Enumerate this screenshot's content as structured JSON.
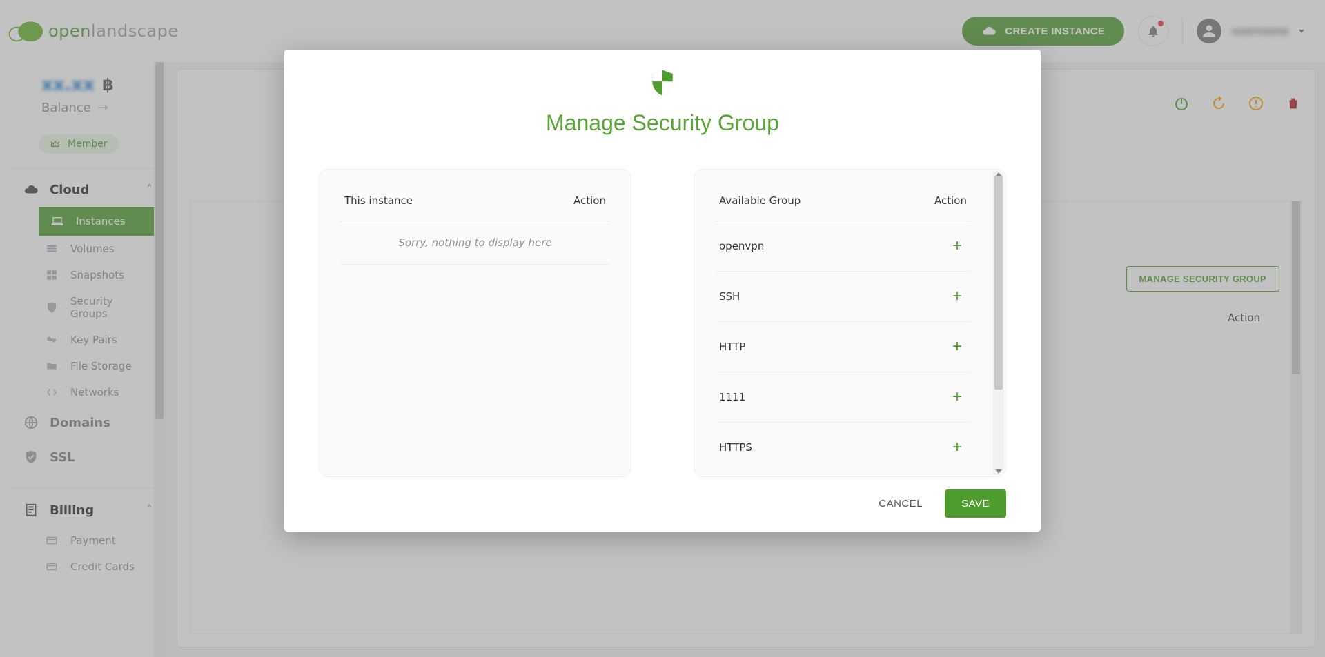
{
  "brand": {
    "part1": "open",
    "part2": "land",
    "part3": "scape"
  },
  "header": {
    "create_label": "CREATE INSTANCE",
    "user_name": "username"
  },
  "sidebar": {
    "balance_amount": "xx.xx",
    "balance_currency": "฿",
    "balance_label": "Balance",
    "member_label": "Member",
    "sections": {
      "cloud": {
        "label": "Cloud",
        "items": [
          {
            "label": "Instances"
          },
          {
            "label": "Volumes"
          },
          {
            "label": "Snapshots"
          },
          {
            "label": "Security Groups"
          },
          {
            "label": "Key Pairs"
          },
          {
            "label": "File Storage"
          },
          {
            "label": "Networks"
          }
        ]
      },
      "domains": {
        "label": "Domains"
      },
      "ssl": {
        "label": "SSL"
      },
      "billing": {
        "label": "Billing",
        "items": [
          {
            "label": "Payment"
          },
          {
            "label": "Credit Cards"
          }
        ]
      }
    }
  },
  "panel": {
    "manage_sg_label": "MANAGE SECURITY GROUP",
    "col_action": "Action"
  },
  "modal": {
    "title": "Manage Security Group",
    "left": {
      "col1": "This instance",
      "col2": "Action",
      "empty": "Sorry, nothing to display here"
    },
    "right": {
      "col1": "Available Group",
      "col2": "Action",
      "groups": [
        {
          "name": "openvpn"
        },
        {
          "name": "SSH"
        },
        {
          "name": "HTTP"
        },
        {
          "name": "1111"
        },
        {
          "name": "HTTPS"
        }
      ]
    },
    "cancel": "CANCEL",
    "save": "SAVE"
  }
}
